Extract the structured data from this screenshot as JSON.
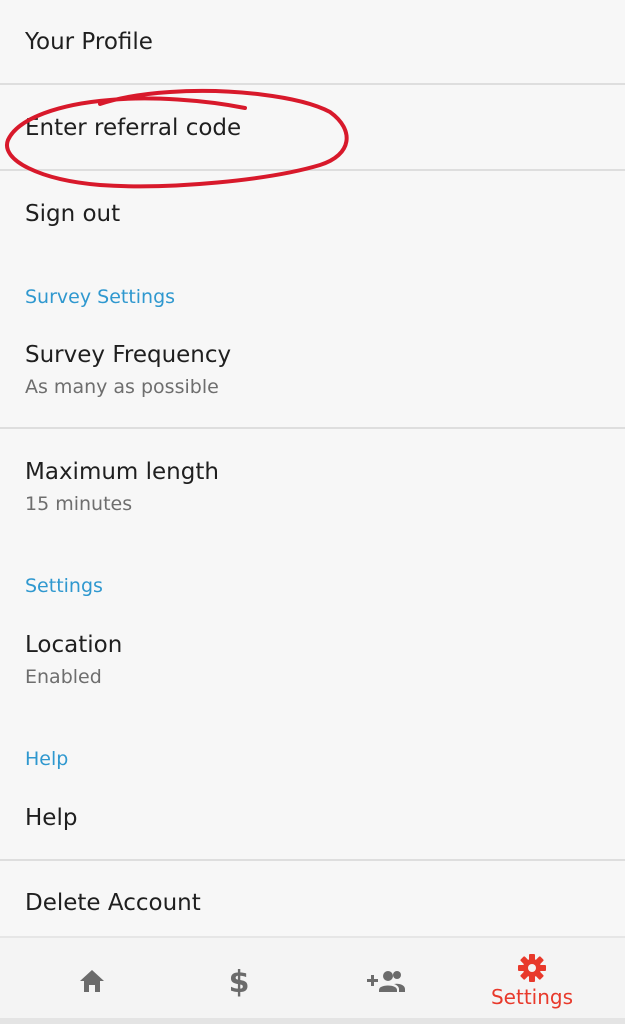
{
  "rows": {
    "your_profile": "Your Profile",
    "enter_referral_code": "Enter referral code",
    "sign_out": "Sign out",
    "survey_frequency": {
      "title": "Survey Frequency",
      "value": "As many as possible"
    },
    "maximum_length": {
      "title": "Maximum length",
      "value": "15 minutes"
    },
    "location": {
      "title": "Location",
      "value": "Enabled"
    },
    "help": "Help",
    "delete_account": "Delete Account"
  },
  "sections": {
    "survey_settings": "Survey Settings",
    "settings": "Settings",
    "help": "Help"
  },
  "bottom_nav": {
    "items": [
      {
        "icon": "home-icon",
        "label": ""
      },
      {
        "icon": "dollar-icon",
        "label": ""
      },
      {
        "icon": "add-people-icon",
        "label": ""
      },
      {
        "icon": "gear-icon",
        "label": "Settings"
      }
    ]
  },
  "colors": {
    "section_header": "#2f98cf",
    "active_tab": "#e8392b",
    "inactive_icon": "#6b6b6b",
    "annotation": "#d8192b",
    "background": "#f7f7f7"
  }
}
